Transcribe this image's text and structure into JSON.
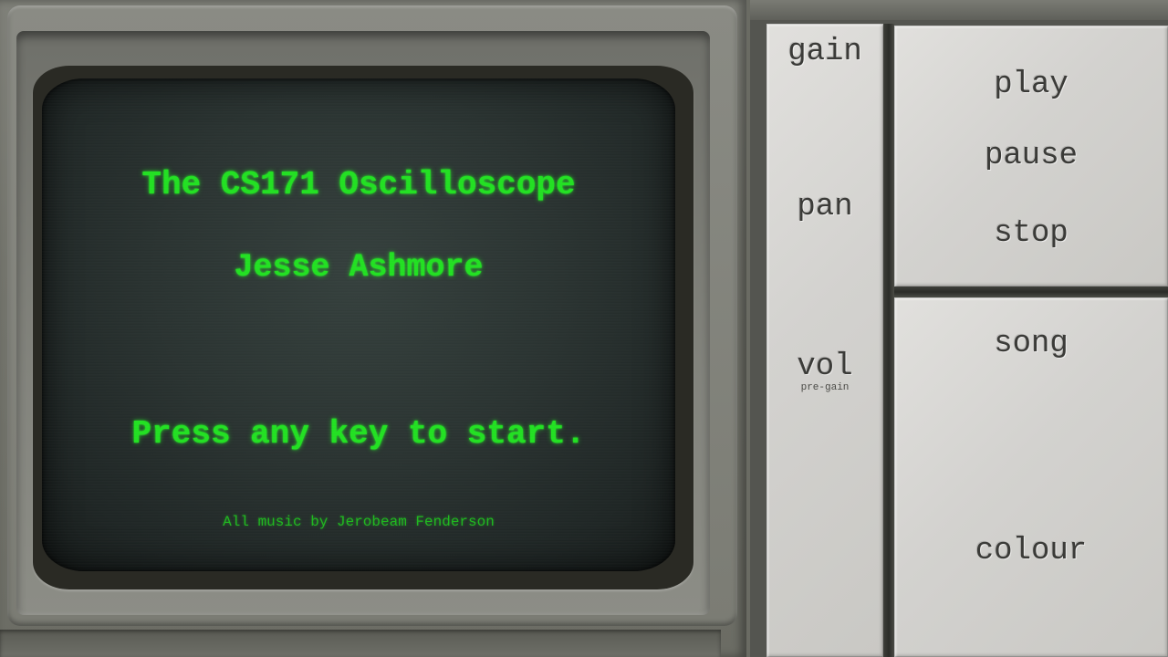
{
  "screen": {
    "title": "The CS171 Oscilloscope",
    "author": "Jesse Ashmore",
    "prompt": "Press any key to start.",
    "credit": "All music by Jerobeam Fenderson"
  },
  "controls": {
    "gain": "gain",
    "pan": "pan",
    "vol": "vol",
    "vol_note": "pre-gain",
    "play": "play",
    "pause": "pause",
    "stop": "stop",
    "song": "song",
    "colour": "colour"
  },
  "colors": {
    "phosphor_green": "#22e022",
    "screen_background": "#2a3331",
    "panel_label": "#3b3b38",
    "casing": "#7b7c74"
  }
}
